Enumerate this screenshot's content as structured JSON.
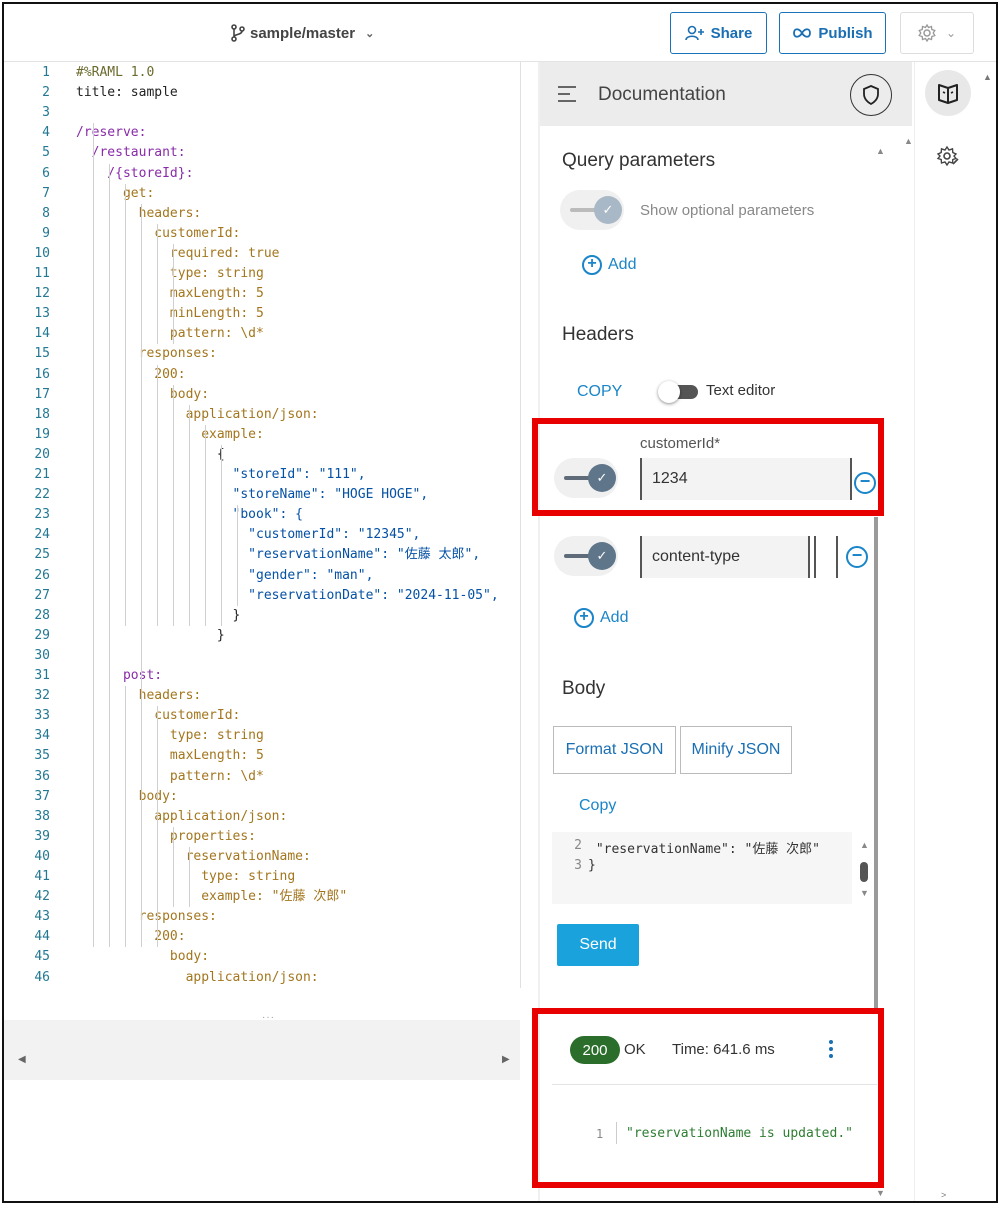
{
  "topbar": {
    "branch": "sample/master",
    "share_label": "Share",
    "publish_label": "Publish"
  },
  "editor": {
    "lines": [
      {
        "n": "1",
        "t": "#%RAML 1.0",
        "c": "k-olive"
      },
      {
        "n": "2",
        "t": "title: sample",
        "c": ""
      },
      {
        "n": "3",
        "t": "",
        "c": ""
      },
      {
        "n": "4",
        "t": "/reserve:",
        "c": "k-purple"
      },
      {
        "n": "5",
        "t": "  /restaurant:",
        "c": "k-purple"
      },
      {
        "n": "6",
        "t": "    /{storeId}:",
        "c": "k-purple"
      },
      {
        "n": "7",
        "t": "      get:",
        "c": "k-brown"
      },
      {
        "n": "8",
        "t": "        headers:",
        "c": "k-brown"
      },
      {
        "n": "9",
        "t": "          customerId:",
        "c": "k-brown"
      },
      {
        "n": "10",
        "t": "            required: true",
        "c": "k-brown"
      },
      {
        "n": "11",
        "t": "            type: string",
        "c": "k-brown"
      },
      {
        "n": "12",
        "t": "            maxLength: 5",
        "c": "k-brown"
      },
      {
        "n": "13",
        "t": "            minLength: 5",
        "c": "k-brown"
      },
      {
        "n": "14",
        "t": "            pattern: \\d*",
        "c": "k-brown"
      },
      {
        "n": "15",
        "t": "        responses:",
        "c": "k-brown"
      },
      {
        "n": "16",
        "t": "          200:",
        "c": "k-brown"
      },
      {
        "n": "17",
        "t": "            body:",
        "c": "k-brown"
      },
      {
        "n": "18",
        "t": "              application/json:",
        "c": "k-brown"
      },
      {
        "n": "19",
        "t": "                example:",
        "c": "k-brown"
      },
      {
        "n": "20",
        "t": "                  {",
        "c": ""
      },
      {
        "n": "21",
        "t": "                    \"storeId\": \"111\",",
        "c": "k-blue"
      },
      {
        "n": "22",
        "t": "                    \"storeName\": \"HOGE HOGE\",",
        "c": "k-blue"
      },
      {
        "n": "23",
        "t": "                    \"book\": {",
        "c": "k-blue"
      },
      {
        "n": "24",
        "t": "                      \"customerId\": \"12345\",",
        "c": "k-blue"
      },
      {
        "n": "25",
        "t": "                      \"reservationName\": \"佐藤 太郎\",",
        "c": "k-blue"
      },
      {
        "n": "26",
        "t": "                      \"gender\": \"man\",",
        "c": "k-blue"
      },
      {
        "n": "27",
        "t": "                      \"reservationDate\": \"2024-11-05\",",
        "c": "k-blue"
      },
      {
        "n": "28",
        "t": "                    }",
        "c": ""
      },
      {
        "n": "29",
        "t": "                  }",
        "c": ""
      },
      {
        "n": "30",
        "t": "",
        "c": ""
      },
      {
        "n": "31",
        "t": "      post:",
        "c": "k-purple"
      },
      {
        "n": "32",
        "t": "        headers:",
        "c": "k-brown"
      },
      {
        "n": "33",
        "t": "          customerId:",
        "c": "k-brown"
      },
      {
        "n": "34",
        "t": "            type: string",
        "c": "k-brown"
      },
      {
        "n": "35",
        "t": "            maxLength: 5",
        "c": "k-brown"
      },
      {
        "n": "36",
        "t": "            pattern: \\d*",
        "c": "k-brown"
      },
      {
        "n": "37",
        "t": "        body:",
        "c": "k-brown"
      },
      {
        "n": "38",
        "t": "          application/json:",
        "c": "k-brown"
      },
      {
        "n": "39",
        "t": "            properties:",
        "c": "k-brown"
      },
      {
        "n": "40",
        "t": "              reservationName:",
        "c": "k-brown"
      },
      {
        "n": "41",
        "t": "                type: string",
        "c": "k-brown"
      },
      {
        "n": "42",
        "t": "                example: \"佐藤 次郎\"",
        "c": "k-brown"
      },
      {
        "n": "43",
        "t": "        responses:",
        "c": "k-brown"
      },
      {
        "n": "44",
        "t": "          200:",
        "c": "k-brown"
      },
      {
        "n": "45",
        "t": "            body:",
        "c": "k-brown"
      },
      {
        "n": "46",
        "t": "              application/json:",
        "c": "k-brown"
      }
    ]
  },
  "documentation": {
    "title": "Documentation",
    "query_params_title": "Query parameters",
    "show_optional_label": "Show optional parameters",
    "add_label": "Add",
    "headers_title": "Headers",
    "copy_label": "COPY",
    "text_editor_label": "Text editor",
    "header1_label": "customerId*",
    "header1_value": "1234",
    "header2_value": "content-type",
    "add2_label": "Add",
    "body_title": "Body",
    "format_json_label": "Format JSON",
    "minify_json_label": "Minify JSON",
    "body_copy_label": "Copy",
    "body_lines": [
      {
        "n": "2",
        "t": " \"reservationName\": \"佐藤 次郎\""
      },
      {
        "n": "3",
        "t": "}"
      }
    ],
    "send_label": "Send"
  },
  "response": {
    "status_code": "200",
    "status_text": "OK",
    "time": "Time: 641.6 ms",
    "line_number": "1",
    "body": "\"reservationName is updated.\""
  },
  "colors": {
    "highlight": "#e80000",
    "accent": "#1a85c8",
    "status_ok": "#2b6e2b",
    "send": "#1aa2dc"
  },
  "icons": [
    "branch-icon",
    "add-user-icon",
    "infinity-icon",
    "gear-icon",
    "menu-icon",
    "shield-icon",
    "book-icon",
    "settings-cog-icon"
  ]
}
